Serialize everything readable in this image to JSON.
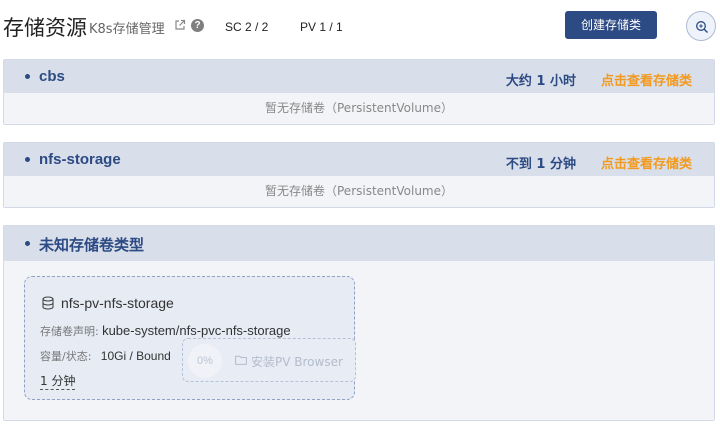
{
  "header": {
    "title": "存储资源",
    "subtitle": "K8s存储管理",
    "sc_stat": "SC 2 / 2",
    "pv_stat": "PV 1 / 1",
    "create_button": "创建存储类"
  },
  "storage_classes": [
    {
      "name": "cbs",
      "age": "大约 1 小时",
      "link": "点击查看存储类",
      "empty_text": "暂无存储卷（PersistentVolume）"
    },
    {
      "name": "nfs-storage",
      "age": "不到 1 分钟",
      "link": "点击查看存储类",
      "empty_text": "暂无存储卷（PersistentVolume）"
    }
  ],
  "unknown_group": {
    "title": "未知存储卷类型",
    "volumes": [
      {
        "name": "nfs-pv-nfs-storage",
        "claim_label": "存储卷声明:",
        "claim_value": "kube-system/nfs-pvc-nfs-storage",
        "capacity_label": "容量/状态:",
        "capacity_value": "10Gi / Bound",
        "age": "1 分钟",
        "browser_progress": "0%",
        "browser_label": "安装PV Browser"
      }
    ]
  },
  "colors": {
    "brand": "#2c4a83",
    "link": "#f39a1e",
    "panel_header": "#d8deea"
  },
  "icons": [
    "external-link-icon",
    "help-icon",
    "zoom-icon",
    "database-icon",
    "folder-icon"
  ]
}
